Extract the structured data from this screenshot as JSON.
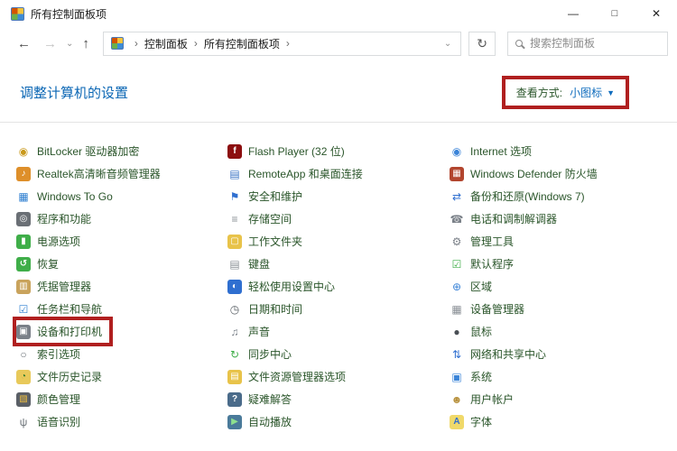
{
  "window": {
    "title": "所有控制面板项",
    "minimize": "—",
    "maximize": "□",
    "close": "✕"
  },
  "navbar": {
    "back": "←",
    "forward": "→",
    "history_caret": "⌄",
    "up": "↑",
    "breadcrumb_separator": "›",
    "breadcrumb": [
      {
        "label": "控制面板"
      },
      {
        "label": "所有控制面板项"
      }
    ],
    "address_caret": "⌄",
    "refresh": "↻",
    "search_placeholder": "搜索控制面板"
  },
  "header": {
    "title": "调整计算机的设置",
    "view_by_label": "查看方式:",
    "view_by_value": "小图标",
    "view_by_caret": "▼"
  },
  "annotations": {
    "highlight_color": "#b01f1f",
    "highlighted_item": "设备和打印机",
    "highlighted_control": "查看方式: 小图标"
  },
  "colors": {
    "link_blue": "#0f6cbd",
    "header_blue": "#0a66b4",
    "item_text": "#2a552a"
  },
  "items": {
    "columns": [
      [
        {
          "label": "BitLocker 驱动器加密",
          "icon": "bitlocker-icon",
          "glyph": "◉",
          "fg": "#c9991c",
          "bg": "none"
        },
        {
          "label": "Realtek高清晰音频管理器",
          "icon": "realtek-audio-icon",
          "glyph": "♪",
          "fg": "#ffffff",
          "bg": "#de8f2a"
        },
        {
          "label": "Windows To Go",
          "icon": "windows-to-go-icon",
          "glyph": "▦",
          "fg": "#2f7fd0",
          "bg": "none"
        },
        {
          "label": "程序和功能",
          "icon": "programs-and-features-icon",
          "glyph": "◎",
          "fg": "#ffffff",
          "bg": "#6a6f75"
        },
        {
          "label": "电源选项",
          "icon": "power-options-icon",
          "glyph": "▮",
          "fg": "#ffffff",
          "bg": "#3fae49"
        },
        {
          "label": "恢复",
          "icon": "recovery-icon",
          "glyph": "↺",
          "fg": "#ffffff",
          "bg": "#3fae49"
        },
        {
          "label": "凭据管理器",
          "icon": "credential-manager-icon",
          "glyph": "▥",
          "fg": "#ffffff",
          "bg": "#c9a35c"
        },
        {
          "label": "任务栏和导航",
          "icon": "taskbar-navigation-icon",
          "glyph": "☑",
          "fg": "#2f7fd0",
          "bg": "none"
        },
        {
          "label": "设备和打印机",
          "icon": "devices-and-printers-icon",
          "glyph": "▣",
          "fg": "#ffffff",
          "bg": "#7a8088",
          "highlighted": true
        },
        {
          "label": "索引选项",
          "icon": "indexing-options-icon",
          "glyph": "○",
          "fg": "#6a7076",
          "bg": "none"
        },
        {
          "label": "文件历史记录",
          "icon": "file-history-icon",
          "glyph": "◔",
          "fg": "#2e7d32",
          "bg": "#e8c95a"
        },
        {
          "label": "颜色管理",
          "icon": "color-management-icon",
          "glyph": "▧",
          "fg": "#f0c040",
          "bg": "#5a5f66"
        },
        {
          "label": "语音识别",
          "icon": "speech-recognition-icon",
          "glyph": "ψ",
          "fg": "#6a7076",
          "bg": "none"
        }
      ],
      [
        {
          "label": "Flash Player (32 位)",
          "icon": "flash-player-icon",
          "glyph": "f",
          "fg": "#ffffff",
          "bg": "#8c0e0f"
        },
        {
          "label": "RemoteApp 和桌面连接",
          "icon": "remoteapp-icon",
          "glyph": "▤",
          "fg": "#3b74c4",
          "bg": "none"
        },
        {
          "label": "安全和维护",
          "icon": "security-and-maintenance-icon",
          "glyph": "⚑",
          "fg": "#2f6fd0",
          "bg": "none"
        },
        {
          "label": "存储空间",
          "icon": "storage-spaces-icon",
          "glyph": "≡",
          "fg": "#8a9096",
          "bg": "none"
        },
        {
          "label": "工作文件夹",
          "icon": "work-folders-icon",
          "glyph": "▢",
          "fg": "#ffffff",
          "bg": "#e8c34a"
        },
        {
          "label": "键盘",
          "icon": "keyboard-icon",
          "glyph": "▤",
          "fg": "#8a9096",
          "bg": "none"
        },
        {
          "label": "轻松使用设置中心",
          "icon": "ease-of-access-icon",
          "glyph": "◐",
          "fg": "#ffffff",
          "bg": "#2f6fd0"
        },
        {
          "label": "日期和时间",
          "icon": "date-and-time-icon",
          "glyph": "◷",
          "fg": "#5a6066",
          "bg": "none"
        },
        {
          "label": "声音",
          "icon": "sound-icon",
          "glyph": "♫",
          "fg": "#7a8088",
          "bg": "none"
        },
        {
          "label": "同步中心",
          "icon": "sync-center-icon",
          "glyph": "↻",
          "fg": "#3fae49",
          "bg": "none"
        },
        {
          "label": "文件资源管理器选项",
          "icon": "file-explorer-options-icon",
          "glyph": "▤",
          "fg": "#ffffff",
          "bg": "#e8c34a"
        },
        {
          "label": "疑难解答",
          "icon": "troubleshooting-icon",
          "glyph": "?",
          "fg": "#ffffff",
          "bg": "#4a6b8a"
        },
        {
          "label": "自动播放",
          "icon": "autoplay-icon",
          "glyph": "▶",
          "fg": "#8ee08e",
          "bg": "#4a7a9a"
        }
      ],
      [
        {
          "label": "Internet 选项",
          "icon": "internet-options-icon",
          "glyph": "◉",
          "fg": "#3b84d8",
          "bg": "none"
        },
        {
          "label": "Windows Defender 防火墙",
          "icon": "windows-defender-firewall-icon",
          "glyph": "▦",
          "fg": "#ffffff",
          "bg": "#b2452e"
        },
        {
          "label": "备份和还原(Windows 7)",
          "icon": "backup-and-restore-icon",
          "glyph": "⇄",
          "fg": "#2f6fd0",
          "bg": "none"
        },
        {
          "label": "电话和调制解调器",
          "icon": "phone-and-modem-icon",
          "glyph": "☎",
          "fg": "#7a8088",
          "bg": "none"
        },
        {
          "label": "管理工具",
          "icon": "administrative-tools-icon",
          "glyph": "⚙",
          "fg": "#7a8088",
          "bg": "none"
        },
        {
          "label": "默认程序",
          "icon": "default-programs-icon",
          "glyph": "☑",
          "fg": "#3fae49",
          "bg": "none"
        },
        {
          "label": "区域",
          "icon": "region-icon",
          "glyph": "⊕",
          "fg": "#3b84d8",
          "bg": "none"
        },
        {
          "label": "设备管理器",
          "icon": "device-manager-icon",
          "glyph": "▦",
          "fg": "#8a9096",
          "bg": "none"
        },
        {
          "label": "鼠标",
          "icon": "mouse-icon",
          "glyph": "●",
          "fg": "#4a4f55",
          "bg": "none"
        },
        {
          "label": "网络和共享中心",
          "icon": "network-and-sharing-center-icon",
          "glyph": "⇅",
          "fg": "#2f6fd0",
          "bg": "none"
        },
        {
          "label": "系统",
          "icon": "system-icon",
          "glyph": "▣",
          "fg": "#3b84d8",
          "bg": "none"
        },
        {
          "label": "用户帐户",
          "icon": "user-accounts-icon",
          "glyph": "☻",
          "fg": "#b8923f",
          "bg": "none"
        },
        {
          "label": "字体",
          "icon": "fonts-icon",
          "glyph": "A",
          "fg": "#2f6fd0",
          "bg": "#f0d96a"
        }
      ]
    ]
  }
}
